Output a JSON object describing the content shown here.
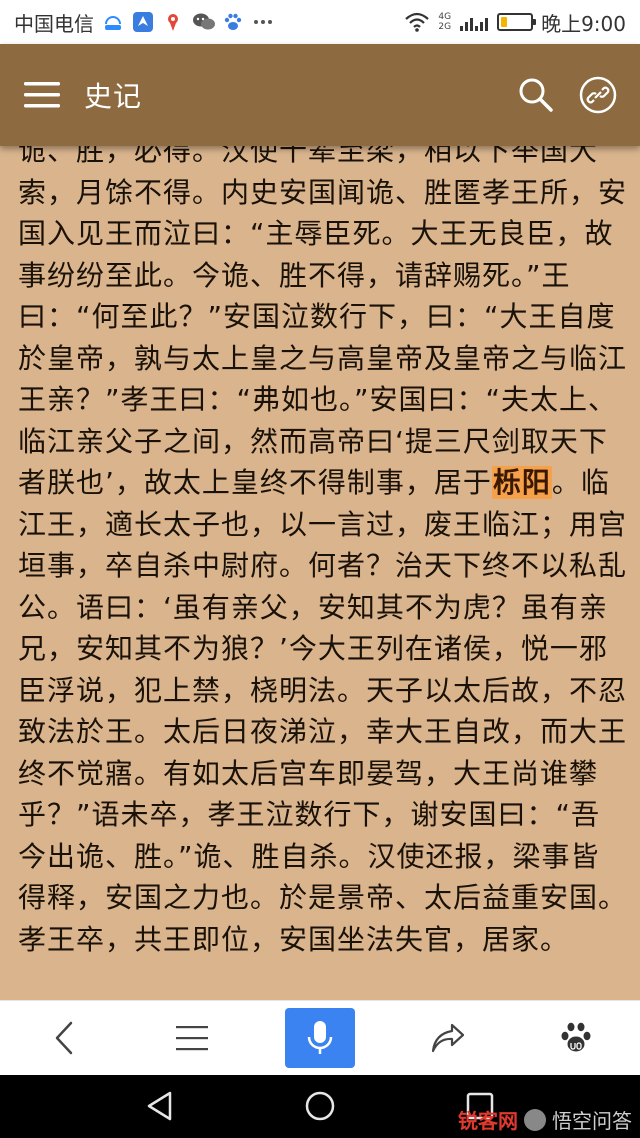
{
  "status_bar": {
    "carrier": "中国电信",
    "network_top": "4G",
    "network_bottom": "2G",
    "time": "晚上9:00",
    "battery_level": 0.2,
    "icons": [
      "hd-call-icon",
      "location-share-icon",
      "maps-icon",
      "wechat-icon",
      "baidu-paw-icon",
      "more-dots-icon",
      "wifi-icon",
      "signal-icon",
      "battery-icon"
    ]
  },
  "app_bar": {
    "title": "史记",
    "bg_color": "#8e6a40",
    "icons": [
      "hamburger-menu-icon",
      "search-icon",
      "link-icon"
    ]
  },
  "article": {
    "bg_color": "#d9b48d",
    "highlight_color": "#f5a04a",
    "text_before": "诡、胜，必得。汉使十辈至梁，相以下举国大索，月馀不得。内史安国闻诡、胜匿孝王所，安国入见王而泣曰：“主辱臣死。大王无良臣，故事纷纷至此。今诡、胜不得，请辞赐死。”王曰：“何至此？”安国泣数行下，曰：“大王自度於皇帝，孰与太上皇之与高皇帝及皇帝之与临江王亲？”孝王曰：“弗如也。”安国曰：“夫太上、临江亲父子之间，然而高帝曰‘提三尺剑取天下者朕也’，故太上皇终不得制事，居于",
    "highlighted": "栎阳",
    "text_after": "。临江王，適长太子也，以一言过，废王临江；用宫垣事，卒自杀中尉府。何者？治天下终不以私乱公。语曰：‘虽有亲父，安知其不为虎？虽有亲兄，安知其不为狼？’今大王列在诸侯，悦一邪臣浮说，犯上禁，桡明法。天子以太后故，不忍致法於王。太后日夜涕泣，幸大王自改，而大王终不觉寤。有如太后宫车即晏驾，大王尚谁攀乎？”语未卒，孝王泣数行下，谢安国曰：“吾今出诡、胜。”诡、胜自杀。汉使还报，梁事皆得释，安国之力也。於是景帝、太后益重安国。孝王卒，共王即位，安国坐法失官，居家。"
  },
  "toolbar": {
    "accent_color": "#3a83f0",
    "icons": [
      "back-chevron-icon",
      "menu-lines-icon",
      "microphone-icon",
      "share-icon",
      "baidu-paw-icon"
    ]
  },
  "nav_bar": {
    "icons": [
      "nav-back-icon",
      "nav-home-icon",
      "nav-recents-icon"
    ]
  },
  "watermark": {
    "red_text": "锐客网",
    "grey_text": "悟空问答"
  }
}
